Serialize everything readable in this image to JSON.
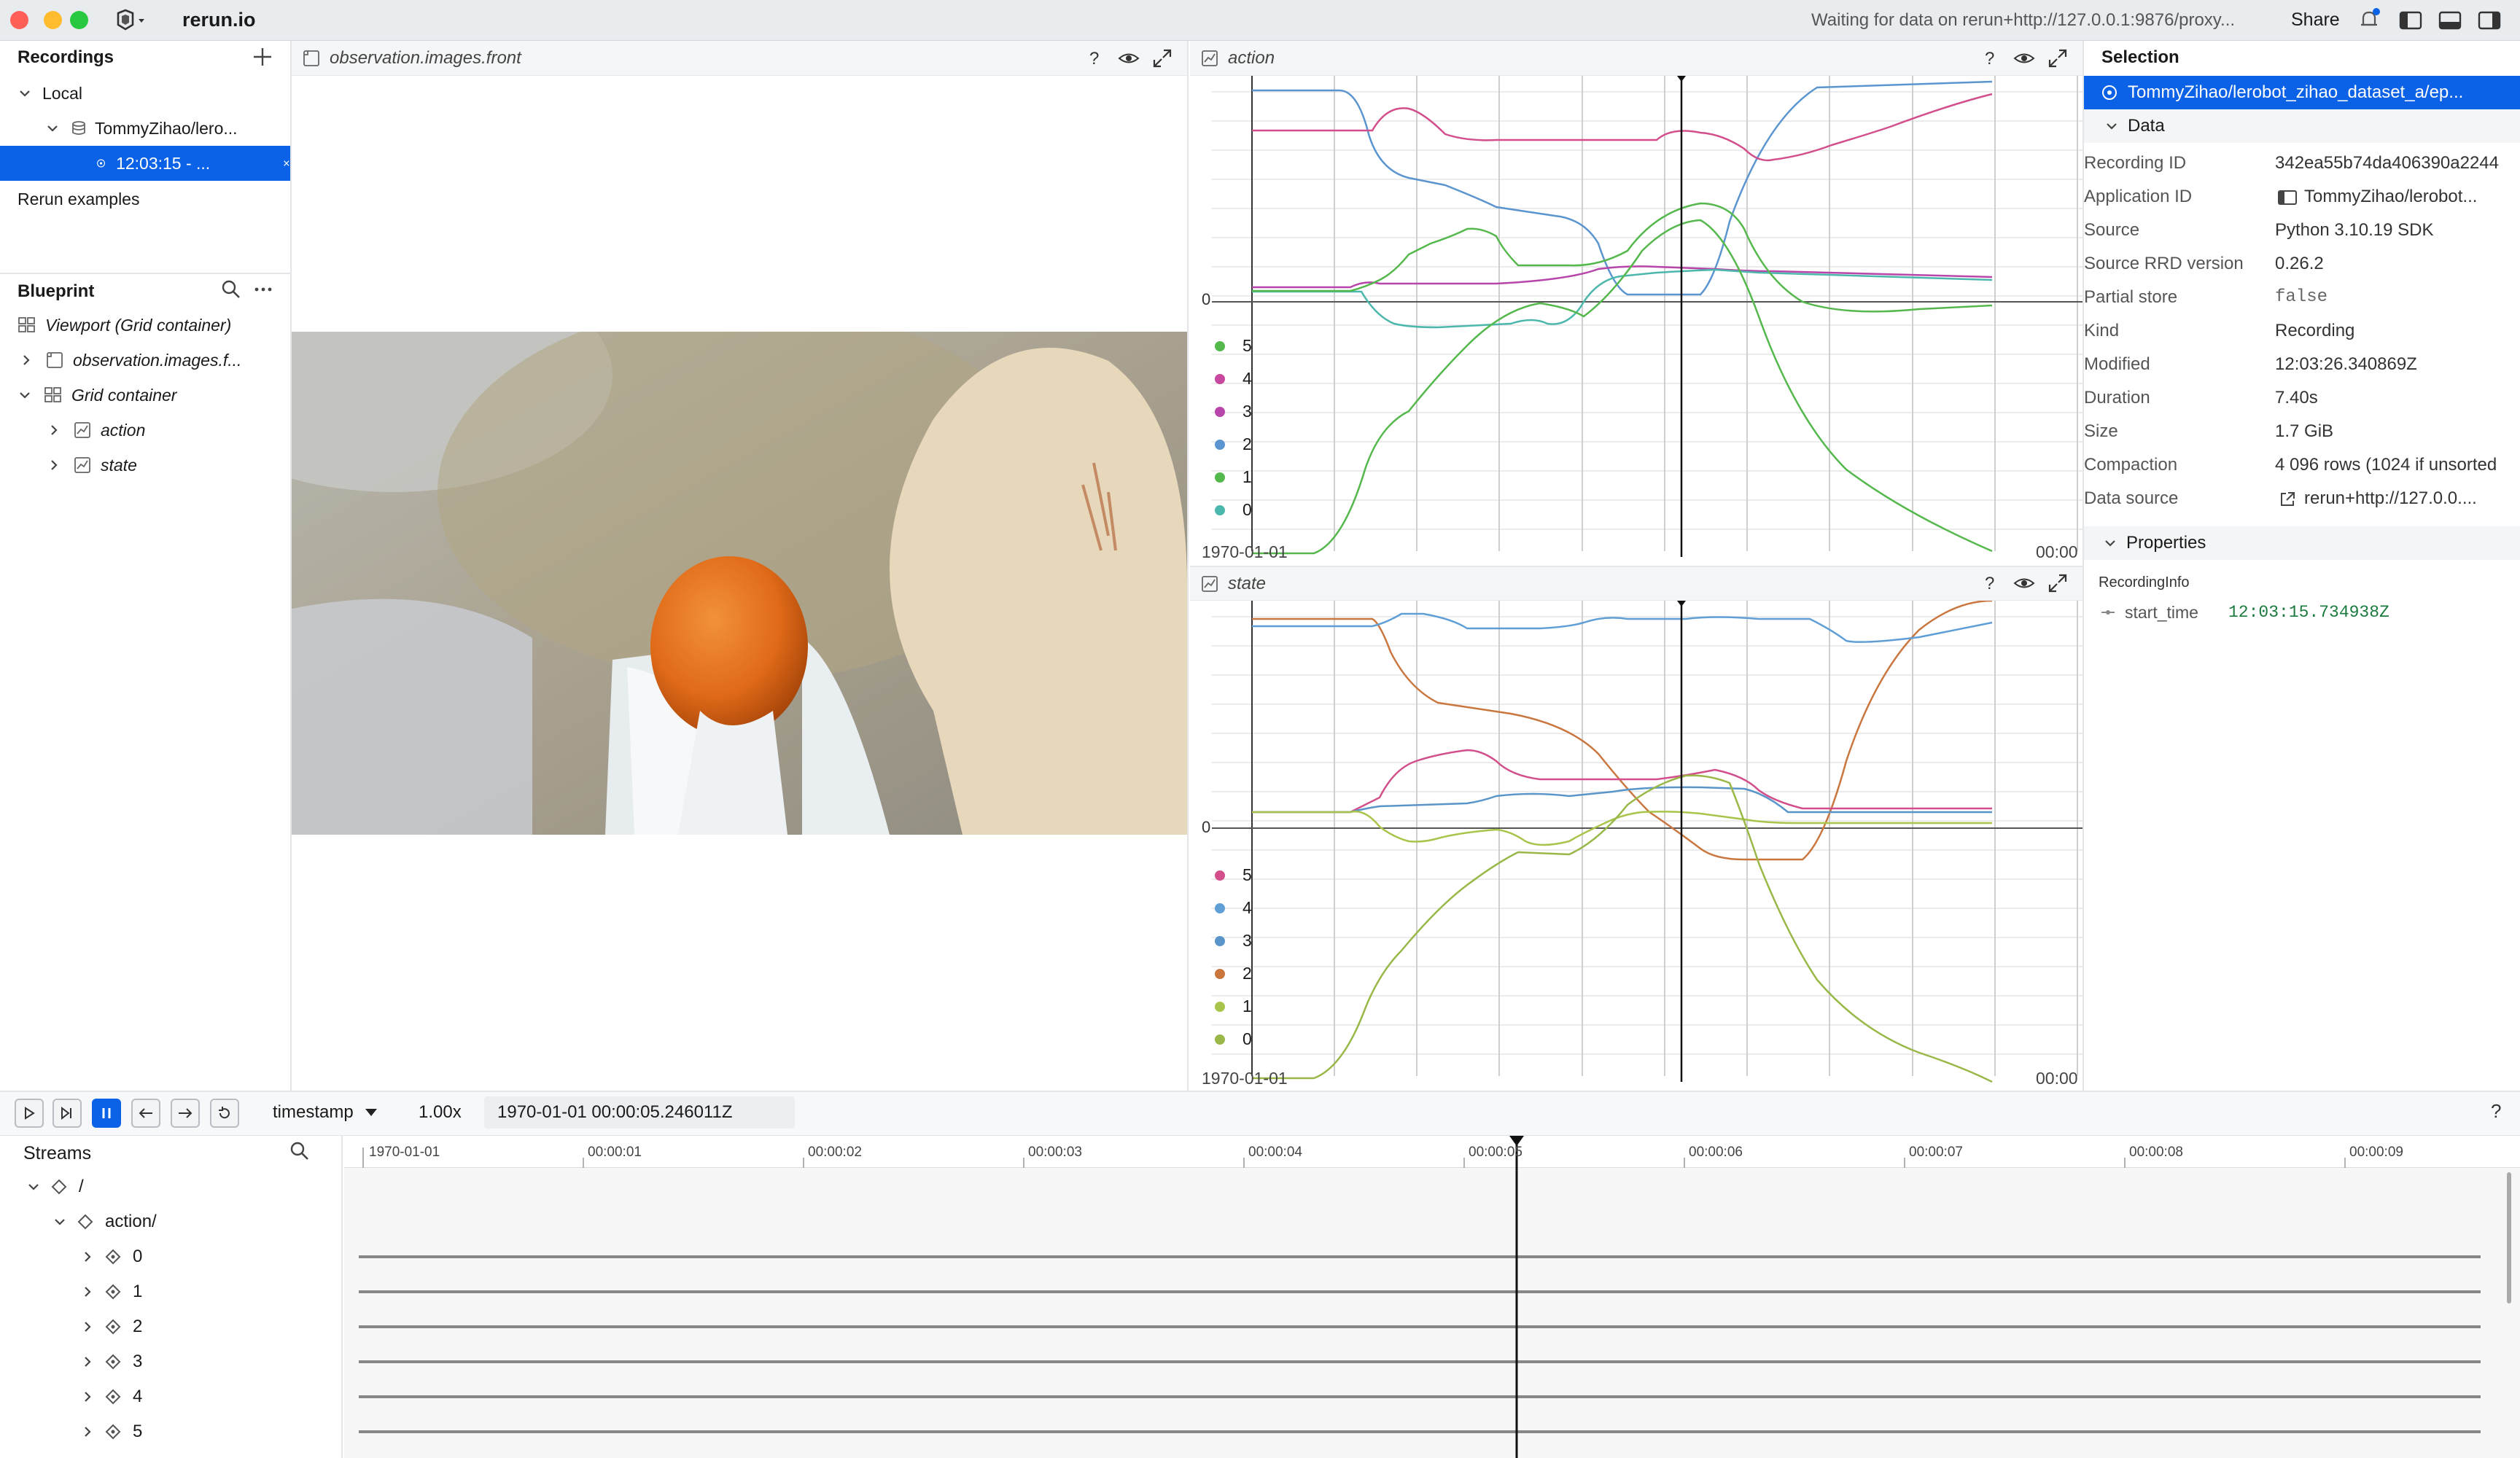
{
  "app": {
    "title": "rerun.io",
    "status": "Waiting for data on rerun+http://127.0.0.1:9876/proxy...",
    "share_label": "Share"
  },
  "recordings": {
    "title": "Recordings",
    "local_label": "Local",
    "dataset_label": "TommyZihao/lero...",
    "recording_label": "12:03:15 - ...",
    "examples_label": "Rerun examples"
  },
  "blueprint": {
    "title": "Blueprint",
    "items": [
      {
        "label": "Viewport (Grid container)"
      },
      {
        "label": "observation.images.f..."
      },
      {
        "label": "Grid container"
      },
      {
        "label": "action"
      },
      {
        "label": "state"
      }
    ]
  },
  "image_view": {
    "tab_label": "observation.images.front"
  },
  "action_view": {
    "tab_label": "action",
    "zero_label": "0",
    "x_start_label": "1970-01-01",
    "x_end_label": "00:00",
    "legend": [
      "5",
      "4",
      "3",
      "2",
      "1",
      "0"
    ]
  },
  "state_view": {
    "tab_label": "state",
    "zero_label": "0",
    "x_start_label": "1970-01-01",
    "x_end_label": "00:00",
    "legend": [
      "5",
      "4",
      "3",
      "2",
      "1",
      "0"
    ]
  },
  "selection": {
    "title": "Selection",
    "selected_label": "TommyZihao/lerobot_zihao_dataset_a/ep...",
    "data_header": "Data",
    "rows": [
      {
        "key": "Recording ID",
        "value": "342ea55b74da406390a2244"
      },
      {
        "key": "Application ID",
        "value": "TommyZihao/lerobot..."
      },
      {
        "key": "Source",
        "value": "Python 3.10.19 SDK"
      },
      {
        "key": "Source RRD version",
        "value": "0.26.2"
      },
      {
        "key": "Partial store",
        "value": "false"
      },
      {
        "key": "Kind",
        "value": "Recording"
      },
      {
        "key": "Modified",
        "value": "12:03:26.340869Z"
      },
      {
        "key": "Duration",
        "value": "7.40s"
      },
      {
        "key": "Size",
        "value": "1.7 GiB"
      },
      {
        "key": "Compaction",
        "value": "4 096 rows (1024 if unsorted"
      },
      {
        "key": "Data source",
        "value": "rerun+http://127.0.0...."
      }
    ],
    "properties_header": "Properties",
    "recording_info_label": "RecordingInfo",
    "start_time_key": "start_time",
    "start_time_value": "12:03:15.734938Z"
  },
  "timeline": {
    "timeline_name": "timestamp",
    "speed": "1.00x",
    "current_time": "1970-01-01 00:00:05.246011Z",
    "streams_title": "Streams",
    "ruler_ticks": [
      "1970-01-01",
      "00:00:01",
      "00:00:02",
      "00:00:03",
      "00:00:04",
      "00:00:05",
      "00:00:06",
      "00:00:07",
      "00:00:08",
      "00:00:09"
    ],
    "root_label": "/",
    "action_label": "action/",
    "stream_items": [
      "0",
      "1",
      "2",
      "3",
      "4",
      "5"
    ]
  },
  "colors": {
    "accent": "#0b62e6",
    "series_action": [
      "#d24f8c",
      "#c8479f",
      "#b845a9",
      "#5b95cf",
      "#55b84d",
      "#4cb7ad"
    ],
    "series_state": [
      "#d24f8c",
      "#5f9fd6",
      "#5a95c9",
      "#c9773f",
      "#a9c44a",
      "#99b848"
    ]
  }
}
